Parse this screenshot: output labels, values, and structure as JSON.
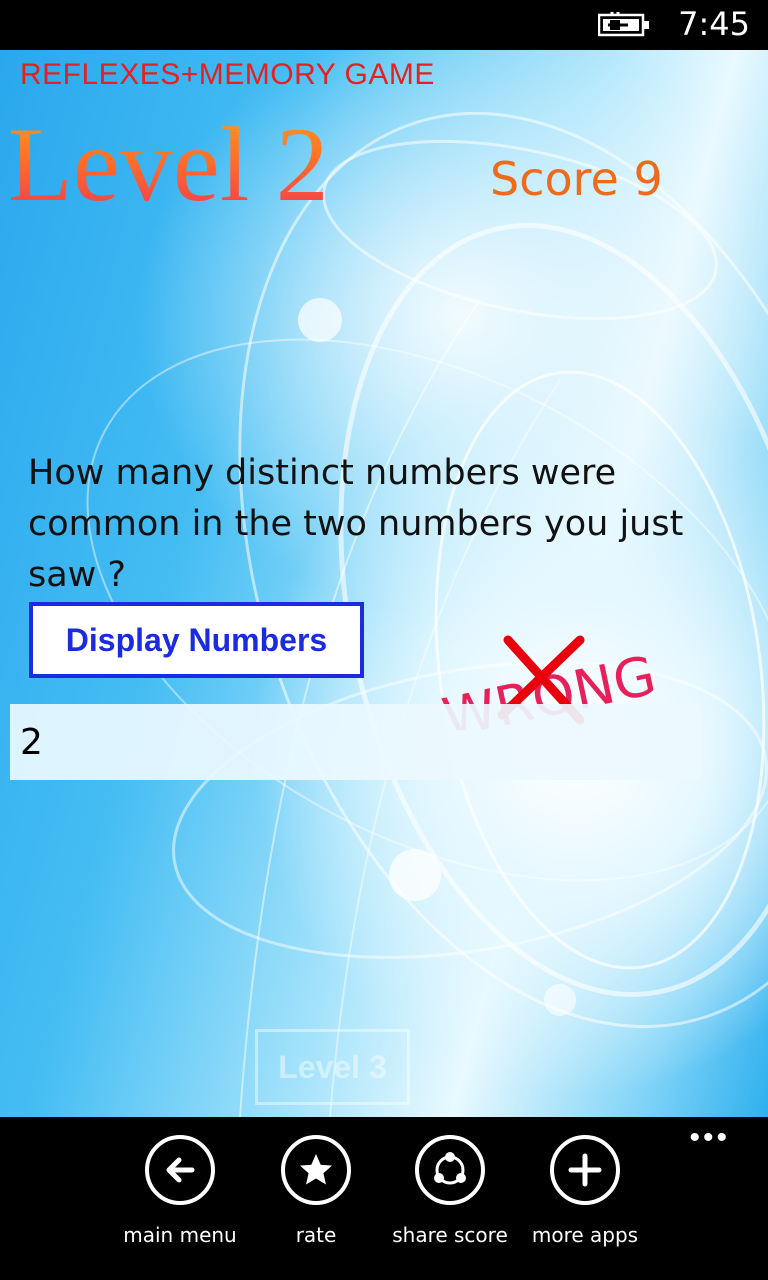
{
  "status_bar": {
    "time": "7:45",
    "battery_icon": "battery-charging-icon"
  },
  "app": {
    "title": "REFLEXES+MEMORY GAME",
    "level": "Level 2",
    "score": "Score 9",
    "question": "How many distinct numbers were common in the two numbers you just saw ?",
    "display_button": "Display Numbers",
    "feedback": "WRONG",
    "answer_value": "2",
    "next_level_button": "Level 3"
  },
  "app_bar": {
    "more": "•••",
    "buttons": [
      {
        "label": "main menu",
        "icon": "back-arrow-icon"
      },
      {
        "label": "rate",
        "icon": "star-icon"
      },
      {
        "label": "share score",
        "icon": "share-icon"
      },
      {
        "label": "more apps",
        "icon": "plus-icon"
      }
    ]
  },
  "colors": {
    "title_red": "#e52020",
    "score_orange": "#ef6a1a",
    "button_blue": "#1a2be0",
    "wrong_pink": "#e8205a",
    "cross_red": "#e8000d"
  }
}
